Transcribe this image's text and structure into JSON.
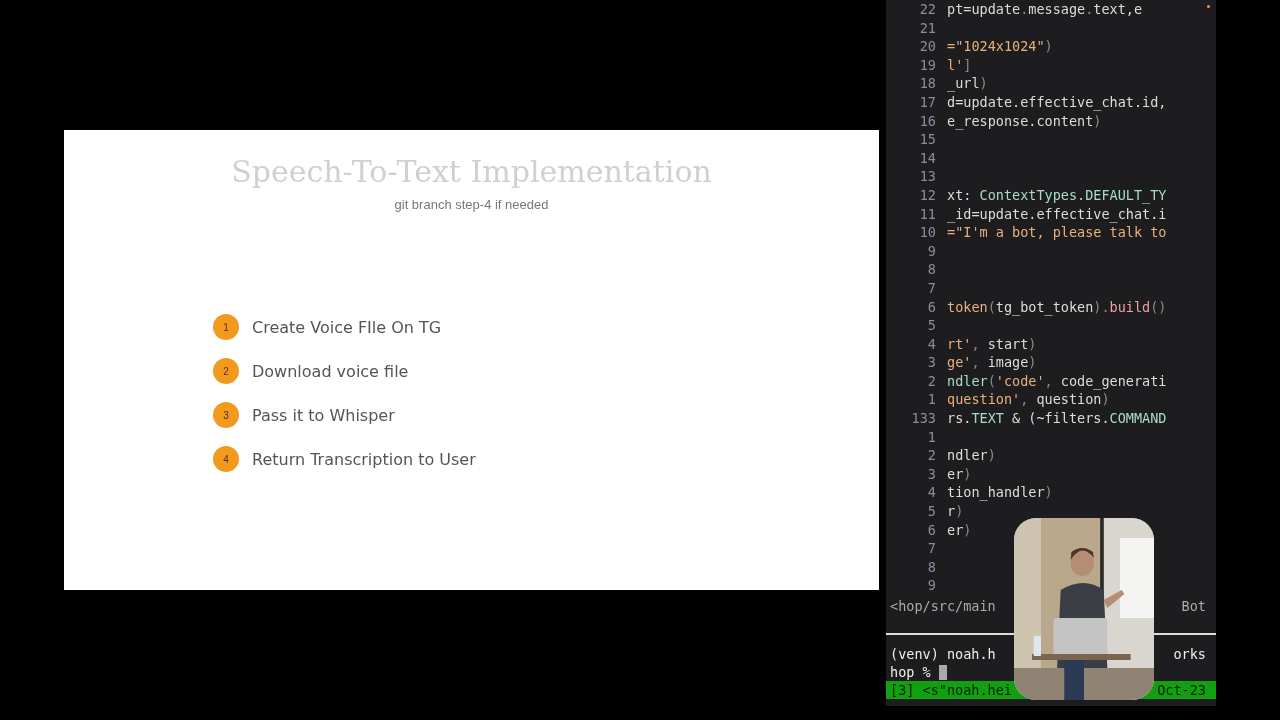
{
  "slide": {
    "title": "Speech-To-Text Implementation",
    "subtitle": "git branch step-4 if needed",
    "steps": [
      {
        "number": "1",
        "text": "Create Voice FIle On TG"
      },
      {
        "number": "2",
        "text": "Download voice file"
      },
      {
        "number": "3",
        "text": "Pass it to Whisper"
      },
      {
        "number": "4",
        "text": "Return Transcription to User"
      }
    ]
  },
  "editor": {
    "lines": [
      {
        "number": "22",
        "code": [
          {
            "text": "pt=update",
            "kind": "plain"
          },
          {
            "text": ".",
            "kind": "punct"
          },
          {
            "text": "message",
            "kind": "plain"
          },
          {
            "text": ".",
            "kind": "punct"
          },
          {
            "text": "text,e",
            "kind": "plain"
          }
        ]
      },
      {
        "number": "21"
      },
      {
        "number": "20",
        "code": [
          {
            "text": "=\"1024x1024\"",
            "kind": "string"
          },
          {
            "text": ")",
            "kind": "punct"
          }
        ]
      },
      {
        "number": "19",
        "code": [
          {
            "text": "l'",
            "kind": "string"
          },
          {
            "text": "]",
            "kind": "punct"
          }
        ]
      },
      {
        "number": "18",
        "code": [
          {
            "text": "_url",
            "kind": "plain"
          },
          {
            "text": ")",
            "kind": "punct"
          }
        ]
      },
      {
        "number": "17",
        "code": [
          {
            "text": "d=update.effective_chat.id,",
            "kind": "plain"
          }
        ]
      },
      {
        "number": "16",
        "code": [
          {
            "text": "e_response.content",
            "kind": "plain"
          },
          {
            "text": ")",
            "kind": "punct"
          }
        ]
      },
      {
        "number": "15"
      },
      {
        "number": "14"
      },
      {
        "number": "13"
      },
      {
        "number": "12",
        "code": [
          {
            "text": "xt: ",
            "kind": "plain"
          },
          {
            "text": "ContextTypes.DEFAULT_TY",
            "kind": "type"
          }
        ]
      },
      {
        "number": "11",
        "code": [
          {
            "text": "_id=update.effective_chat.i",
            "kind": "plain"
          }
        ]
      },
      {
        "number": "10",
        "code": [
          {
            "text": "=\"I'm a bot, please talk to",
            "kind": "string"
          }
        ]
      },
      {
        "number": "9"
      },
      {
        "number": "8"
      },
      {
        "number": "7"
      },
      {
        "number": "6",
        "code": [
          {
            "text": "token",
            "kind": "string"
          },
          {
            "text": "(",
            "kind": "punct"
          },
          {
            "text": "tg_bot_token",
            "kind": "plain"
          },
          {
            "text": ").",
            "kind": "punct"
          },
          {
            "text": "build",
            "kind": "call"
          },
          {
            "text": "()",
            "kind": "punct"
          }
        ]
      },
      {
        "number": "5"
      },
      {
        "number": "4",
        "code": [
          {
            "text": "rt'",
            "kind": "string"
          },
          {
            "text": ", ",
            "kind": "punct"
          },
          {
            "text": "start",
            "kind": "plain"
          },
          {
            "text": ")",
            "kind": "punct"
          }
        ]
      },
      {
        "number": "3",
        "code": [
          {
            "text": "ge'",
            "kind": "string"
          },
          {
            "text": ", ",
            "kind": "punct"
          },
          {
            "text": "image",
            "kind": "plain"
          },
          {
            "text": ")",
            "kind": "punct"
          }
        ]
      },
      {
        "number": "2",
        "code": [
          {
            "text": "ndler",
            "kind": "type"
          },
          {
            "text": "(",
            "kind": "punct"
          },
          {
            "text": "'code'",
            "kind": "string"
          },
          {
            "text": ", ",
            "kind": "punct"
          },
          {
            "text": "code_generati",
            "kind": "plain"
          }
        ]
      },
      {
        "number": "1",
        "code": [
          {
            "text": "question'",
            "kind": "string"
          },
          {
            "text": ", ",
            "kind": "punct"
          },
          {
            "text": "question",
            "kind": "plain"
          },
          {
            "text": ")",
            "kind": "punct"
          }
        ]
      },
      {
        "number": "133",
        "code": [
          {
            "text": "rs.",
            "kind": "plain"
          },
          {
            "text": "TEXT",
            "kind": "type"
          },
          {
            "text": " & (~filters.",
            "kind": "plain"
          },
          {
            "text": "COMMAND",
            "kind": "type"
          }
        ]
      },
      {
        "number": "1"
      },
      {
        "number": "2",
        "code": [
          {
            "text": "ndler",
            "kind": "plain"
          },
          {
            "text": ")",
            "kind": "punct"
          }
        ]
      },
      {
        "number": "3",
        "code": [
          {
            "text": "er",
            "kind": "plain"
          },
          {
            "text": ")",
            "kind": "punct"
          }
        ]
      },
      {
        "number": "4",
        "code": [
          {
            "text": "tion_handler",
            "kind": "plain"
          },
          {
            "text": ")",
            "kind": "punct"
          }
        ]
      },
      {
        "number": "5",
        "code": [
          {
            "text": "r",
            "kind": "plain"
          },
          {
            "text": ")",
            "kind": "punct"
          }
        ]
      },
      {
        "number": "6",
        "code": [
          {
            "text": "er",
            "kind": "plain"
          },
          {
            "text": ")",
            "kind": "punct"
          }
        ]
      },
      {
        "number": "7"
      },
      {
        "number": "8"
      },
      {
        "number": "9"
      }
    ],
    "status_left": "<hop/src/main",
    "status_right": "Bot"
  },
  "terminal": {
    "line_1_left": "(venv) noah.h",
    "line_1_right": "orks",
    "prompt": "hop %",
    "tmux_left": "[3] <s\"noah.hei",
    "tmux_right": "Oct-23"
  }
}
